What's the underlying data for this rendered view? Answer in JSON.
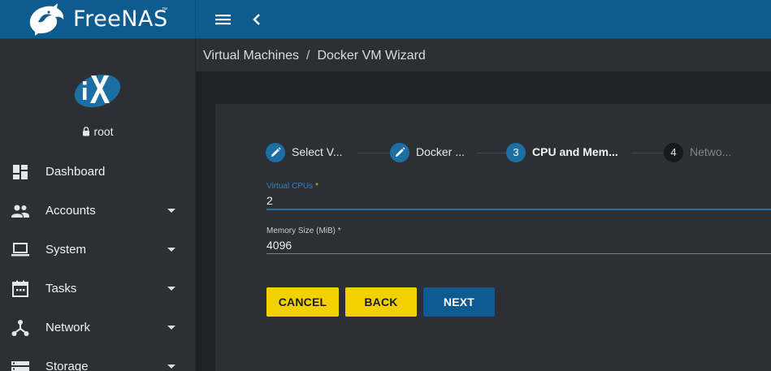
{
  "brand": {
    "name": "FreeNAS",
    "tm": "™"
  },
  "sidebar": {
    "user": "root",
    "items": [
      {
        "label": "Dashboard",
        "icon": "dashboard-icon",
        "has_caret": false
      },
      {
        "label": "Accounts",
        "icon": "people-icon",
        "has_caret": true
      },
      {
        "label": "System",
        "icon": "laptop-icon",
        "has_caret": true
      },
      {
        "label": "Tasks",
        "icon": "calendar-icon",
        "has_caret": true
      },
      {
        "label": "Network",
        "icon": "network-icon",
        "has_caret": true
      },
      {
        "label": "Storage",
        "icon": "storage-icon",
        "has_caret": true
      }
    ]
  },
  "breadcrumb": {
    "parent": "Virtual Machines",
    "separator": "/",
    "current": "Docker VM Wizard"
  },
  "wizard": {
    "steps": [
      {
        "marker": "edit-icon",
        "label": "Select V...",
        "state": "completed"
      },
      {
        "marker": "edit-icon",
        "label": "Docker ...",
        "state": "completed"
      },
      {
        "marker": "3",
        "label": "CPU and Mem...",
        "state": "active"
      },
      {
        "marker": "4",
        "label": "Netwo...",
        "state": "pending"
      }
    ],
    "fields": {
      "vcpus": {
        "label": "Virtual CPUs",
        "required_mark": "*",
        "value": "2"
      },
      "memory": {
        "label": "Memory Size (MiB)",
        "required_mark": "*",
        "value": "4096"
      }
    },
    "buttons": {
      "cancel": "CANCEL",
      "back": "BACK",
      "next": "NEXT"
    }
  },
  "colors": {
    "topbar": "#0e5c8f",
    "accent_blue": "#1d6ea3",
    "button_yellow": "#f3d100",
    "button_blue": "#0d5b91"
  }
}
